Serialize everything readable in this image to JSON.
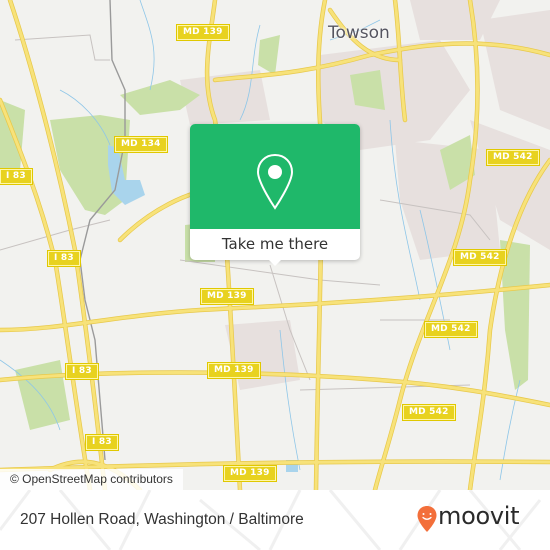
{
  "map": {
    "city_label": "Towson",
    "route_shields": [
      {
        "label": "MD 139"
      },
      {
        "label": "MD 134"
      },
      {
        "label": "I 83"
      },
      {
        "label": "I 83"
      },
      {
        "label": "MD 542"
      },
      {
        "label": "MD 542"
      },
      {
        "label": "MD 542"
      },
      {
        "label": "MD 139"
      },
      {
        "label": "I 83"
      },
      {
        "label": "MD 139"
      },
      {
        "label": "MD 542"
      },
      {
        "label": "I 83"
      },
      {
        "label": "MD 139"
      }
    ],
    "attribution": "© OpenStreetMap contributors",
    "colors": {
      "background": "#f2f2ef",
      "major_road": "#f5dd5b",
      "park": "#c8e0a6",
      "water": "#a9d4ec",
      "urban": "#e8e1df",
      "shield": "#e8d21f"
    }
  },
  "popup": {
    "icon": "map-pin-icon",
    "cta_label": "Take me there",
    "accent_color": "#1fb86a"
  },
  "footer": {
    "address": "207 Hollen Road, Washington / Baltimore",
    "brand": "moovit",
    "brand_color": "#f36f3a"
  }
}
